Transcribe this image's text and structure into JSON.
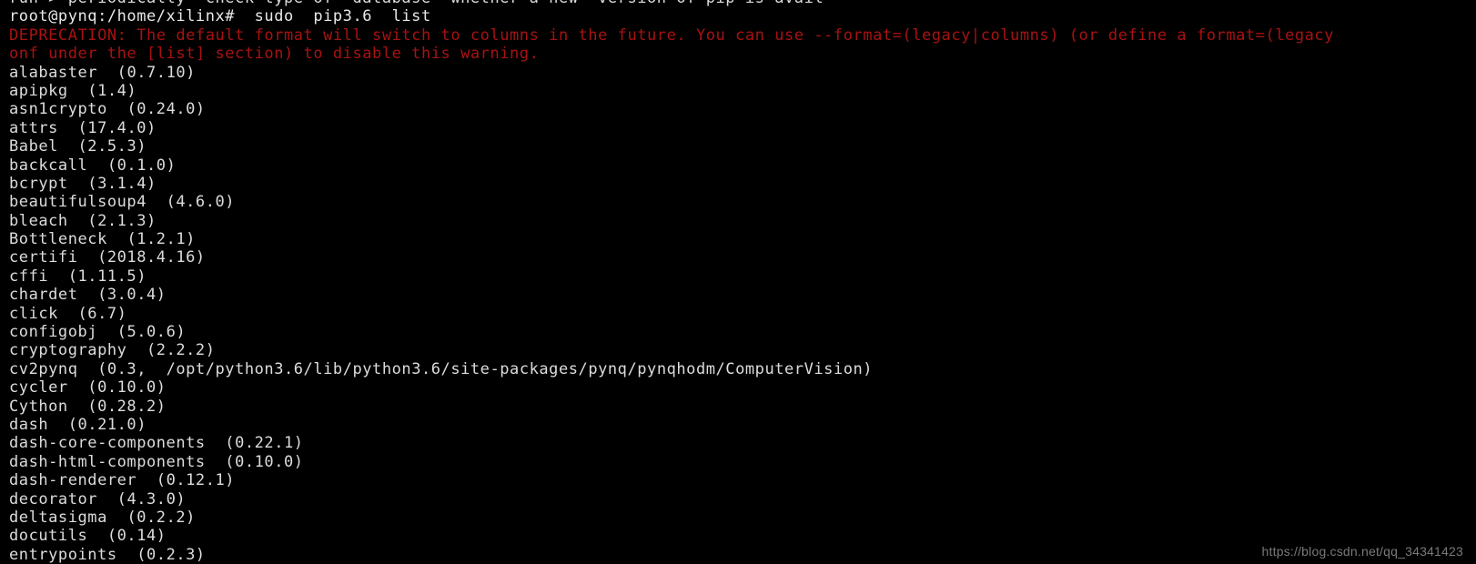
{
  "terminal": {
    "colors": {
      "background": "#000000",
      "foreground": "#dcdcdc",
      "warning": "#a81212",
      "watermark": "#7a7a7a"
    },
    "scrollback_top_partial": "run > periodically  check type of  database  whether a new  version of pip is avail",
    "prompt_line": "root@pynq:/home/xilinx#  sudo  pip3.6  list",
    "deprecation_lines": [
      "DEPRECATION: The default format will switch to columns in the future. You can use --format=(legacy|columns) (or define a format=(legacy",
      "onf under the [list] section) to disable this warning."
    ],
    "packages": [
      {
        "name": "alabaster",
        "version": "(0.7.10)"
      },
      {
        "name": "apipkg",
        "version": "(1.4)"
      },
      {
        "name": "asn1crypto",
        "version": "(0.24.0)"
      },
      {
        "name": "attrs",
        "version": "(17.4.0)"
      },
      {
        "name": "Babel",
        "version": "(2.5.3)"
      },
      {
        "name": "backcall",
        "version": "(0.1.0)"
      },
      {
        "name": "bcrypt",
        "version": "(3.1.4)"
      },
      {
        "name": "beautifulsoup4",
        "version": "(4.6.0)"
      },
      {
        "name": "bleach",
        "version": "(2.1.3)"
      },
      {
        "name": "Bottleneck",
        "version": "(1.2.1)"
      },
      {
        "name": "certifi",
        "version": "(2018.4.16)"
      },
      {
        "name": "cffi",
        "version": "(1.11.5)"
      },
      {
        "name": "chardet",
        "version": "(3.0.4)"
      },
      {
        "name": "click",
        "version": "(6.7)"
      },
      {
        "name": "configobj",
        "version": "(5.0.6)"
      },
      {
        "name": "cryptography",
        "version": "(2.2.2)"
      },
      {
        "name": "cv2pynq",
        "version": "(0.3,  /opt/python3.6/lib/python3.6/site-packages/pynq/pynqhodm/ComputerVision)"
      },
      {
        "name": "cycler",
        "version": "(0.10.0)"
      },
      {
        "name": "Cython",
        "version": "(0.28.2)"
      },
      {
        "name": "dash",
        "version": "(0.21.0)"
      },
      {
        "name": "dash-core-components",
        "version": "(0.22.1)"
      },
      {
        "name": "dash-html-components",
        "version": "(0.10.0)"
      },
      {
        "name": "dash-renderer",
        "version": "(0.12.1)"
      },
      {
        "name": "decorator",
        "version": "(4.3.0)"
      },
      {
        "name": "deltasigma",
        "version": "(0.2.2)"
      },
      {
        "name": "docutils",
        "version": "(0.14)"
      },
      {
        "name": "entrypoints",
        "version": "(0.2.3)"
      }
    ],
    "watermark": "https://blog.csdn.net/qq_34341423"
  }
}
